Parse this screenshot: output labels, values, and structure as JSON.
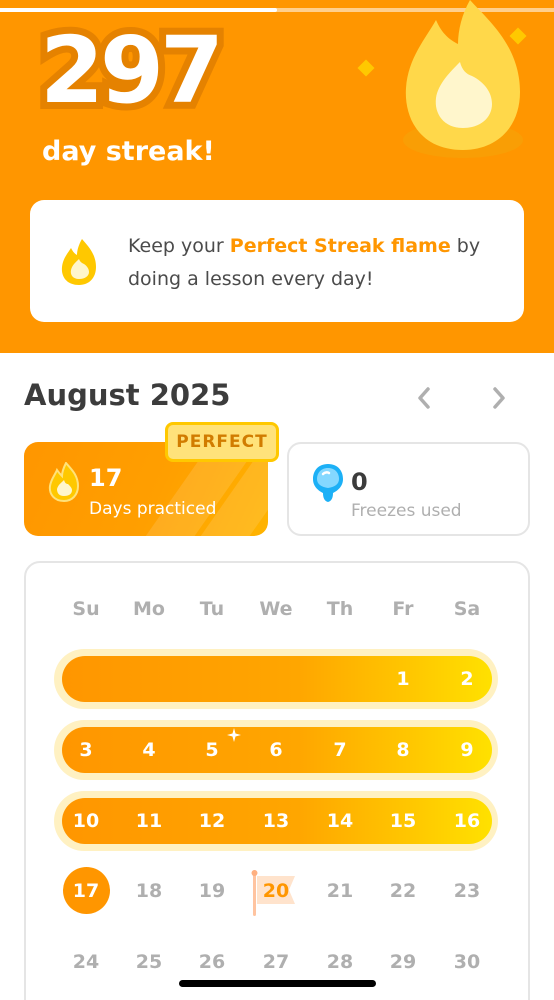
{
  "header": {
    "streak_count": "297",
    "streak_label": "day streak!",
    "info_prefix": "Keep your ",
    "info_highlight": "Perfect Streak flame",
    "info_suffix": " by doing a lesson every day!"
  },
  "calendar_header": {
    "month_title": "August 2025"
  },
  "stats": {
    "perfect_badge": "PERFECT",
    "days_practiced_value": "17",
    "days_practiced_label": "Days practiced",
    "freezes_value": "0",
    "freezes_label": "Freezes used"
  },
  "calendar": {
    "weekdays": [
      "Su",
      "Mo",
      "Tu",
      "We",
      "Th",
      "Fr",
      "Sa"
    ],
    "week1": [
      "1",
      "2"
    ],
    "week2": [
      "3",
      "4",
      "5",
      "6",
      "7",
      "8",
      "9"
    ],
    "week3": [
      "10",
      "11",
      "12",
      "13",
      "14",
      "15",
      "16"
    ],
    "week4": [
      "17",
      "18",
      "19",
      "20",
      "21",
      "22",
      "23"
    ],
    "week5": [
      "24",
      "25",
      "26",
      "27",
      "28",
      "29",
      "30"
    ]
  },
  "colors": {
    "brand_orange": "#ff9600",
    "gold": "#ffc800",
    "muted_gray": "#afafaf",
    "text_dark": "#3c3c3c"
  },
  "icons": [
    "flame-icon",
    "chevron-left-icon",
    "chevron-right-icon",
    "freeze-icon",
    "sparkle-icon",
    "goal-flag-icon"
  ]
}
